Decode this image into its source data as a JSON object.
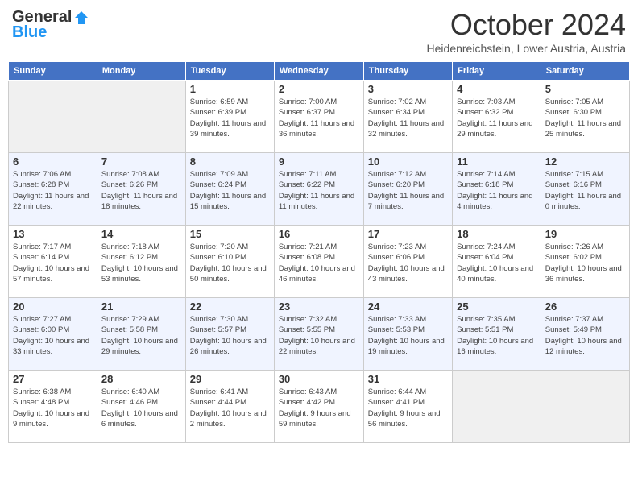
{
  "header": {
    "logo_general": "General",
    "logo_blue": "Blue",
    "title": "October 2024",
    "subtitle": "Heidenreichstein, Lower Austria, Austria"
  },
  "days_of_week": [
    "Sunday",
    "Monday",
    "Tuesday",
    "Wednesday",
    "Thursday",
    "Friday",
    "Saturday"
  ],
  "weeks": [
    [
      {
        "day": "",
        "info": ""
      },
      {
        "day": "",
        "info": ""
      },
      {
        "day": "1",
        "info": "Sunrise: 6:59 AM\nSunset: 6:39 PM\nDaylight: 11 hours and 39 minutes."
      },
      {
        "day": "2",
        "info": "Sunrise: 7:00 AM\nSunset: 6:37 PM\nDaylight: 11 hours and 36 minutes."
      },
      {
        "day": "3",
        "info": "Sunrise: 7:02 AM\nSunset: 6:34 PM\nDaylight: 11 hours and 32 minutes."
      },
      {
        "day": "4",
        "info": "Sunrise: 7:03 AM\nSunset: 6:32 PM\nDaylight: 11 hours and 29 minutes."
      },
      {
        "day": "5",
        "info": "Sunrise: 7:05 AM\nSunset: 6:30 PM\nDaylight: 11 hours and 25 minutes."
      }
    ],
    [
      {
        "day": "6",
        "info": "Sunrise: 7:06 AM\nSunset: 6:28 PM\nDaylight: 11 hours and 22 minutes."
      },
      {
        "day": "7",
        "info": "Sunrise: 7:08 AM\nSunset: 6:26 PM\nDaylight: 11 hours and 18 minutes."
      },
      {
        "day": "8",
        "info": "Sunrise: 7:09 AM\nSunset: 6:24 PM\nDaylight: 11 hours and 15 minutes."
      },
      {
        "day": "9",
        "info": "Sunrise: 7:11 AM\nSunset: 6:22 PM\nDaylight: 11 hours and 11 minutes."
      },
      {
        "day": "10",
        "info": "Sunrise: 7:12 AM\nSunset: 6:20 PM\nDaylight: 11 hours and 7 minutes."
      },
      {
        "day": "11",
        "info": "Sunrise: 7:14 AM\nSunset: 6:18 PM\nDaylight: 11 hours and 4 minutes."
      },
      {
        "day": "12",
        "info": "Sunrise: 7:15 AM\nSunset: 6:16 PM\nDaylight: 11 hours and 0 minutes."
      }
    ],
    [
      {
        "day": "13",
        "info": "Sunrise: 7:17 AM\nSunset: 6:14 PM\nDaylight: 10 hours and 57 minutes."
      },
      {
        "day": "14",
        "info": "Sunrise: 7:18 AM\nSunset: 6:12 PM\nDaylight: 10 hours and 53 minutes."
      },
      {
        "day": "15",
        "info": "Sunrise: 7:20 AM\nSunset: 6:10 PM\nDaylight: 10 hours and 50 minutes."
      },
      {
        "day": "16",
        "info": "Sunrise: 7:21 AM\nSunset: 6:08 PM\nDaylight: 10 hours and 46 minutes."
      },
      {
        "day": "17",
        "info": "Sunrise: 7:23 AM\nSunset: 6:06 PM\nDaylight: 10 hours and 43 minutes."
      },
      {
        "day": "18",
        "info": "Sunrise: 7:24 AM\nSunset: 6:04 PM\nDaylight: 10 hours and 40 minutes."
      },
      {
        "day": "19",
        "info": "Sunrise: 7:26 AM\nSunset: 6:02 PM\nDaylight: 10 hours and 36 minutes."
      }
    ],
    [
      {
        "day": "20",
        "info": "Sunrise: 7:27 AM\nSunset: 6:00 PM\nDaylight: 10 hours and 33 minutes."
      },
      {
        "day": "21",
        "info": "Sunrise: 7:29 AM\nSunset: 5:58 PM\nDaylight: 10 hours and 29 minutes."
      },
      {
        "day": "22",
        "info": "Sunrise: 7:30 AM\nSunset: 5:57 PM\nDaylight: 10 hours and 26 minutes."
      },
      {
        "day": "23",
        "info": "Sunrise: 7:32 AM\nSunset: 5:55 PM\nDaylight: 10 hours and 22 minutes."
      },
      {
        "day": "24",
        "info": "Sunrise: 7:33 AM\nSunset: 5:53 PM\nDaylight: 10 hours and 19 minutes."
      },
      {
        "day": "25",
        "info": "Sunrise: 7:35 AM\nSunset: 5:51 PM\nDaylight: 10 hours and 16 minutes."
      },
      {
        "day": "26",
        "info": "Sunrise: 7:37 AM\nSunset: 5:49 PM\nDaylight: 10 hours and 12 minutes."
      }
    ],
    [
      {
        "day": "27",
        "info": "Sunrise: 6:38 AM\nSunset: 4:48 PM\nDaylight: 10 hours and 9 minutes."
      },
      {
        "day": "28",
        "info": "Sunrise: 6:40 AM\nSunset: 4:46 PM\nDaylight: 10 hours and 6 minutes."
      },
      {
        "day": "29",
        "info": "Sunrise: 6:41 AM\nSunset: 4:44 PM\nDaylight: 10 hours and 2 minutes."
      },
      {
        "day": "30",
        "info": "Sunrise: 6:43 AM\nSunset: 4:42 PM\nDaylight: 9 hours and 59 minutes."
      },
      {
        "day": "31",
        "info": "Sunrise: 6:44 AM\nSunset: 4:41 PM\nDaylight: 9 hours and 56 minutes."
      },
      {
        "day": "",
        "info": ""
      },
      {
        "day": "",
        "info": ""
      }
    ]
  ]
}
